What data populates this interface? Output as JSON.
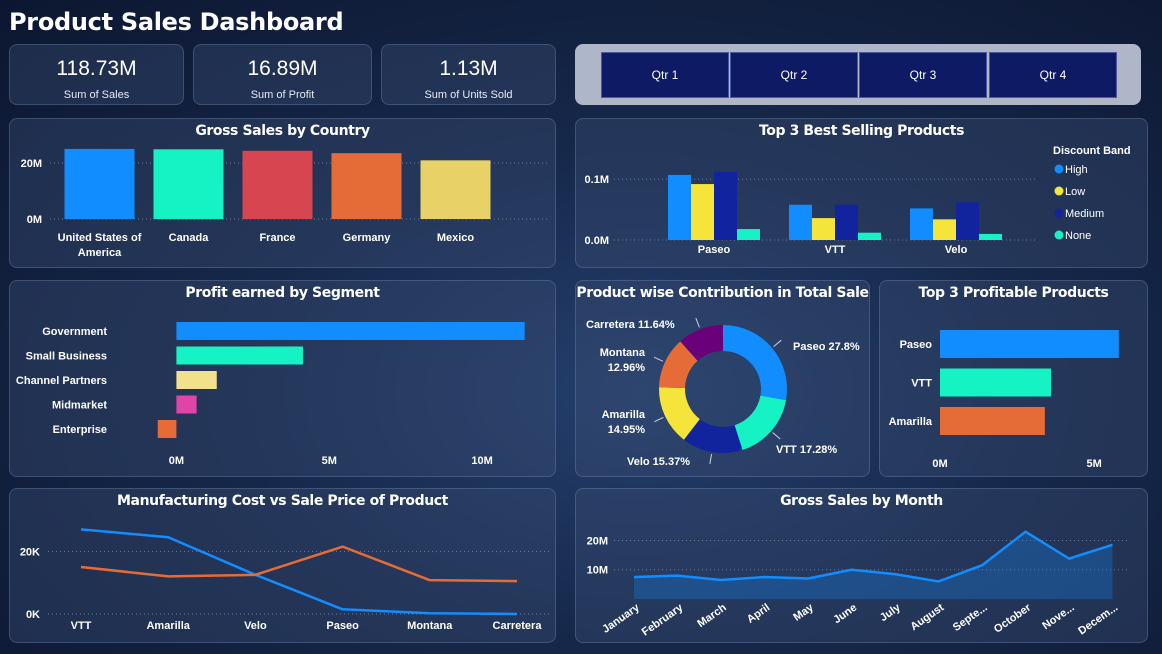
{
  "dashboard_title": "Product Sales Dashboard",
  "kpis": [
    {
      "value": "118.73M",
      "label": "Sum of  Sales"
    },
    {
      "value": "16.89M",
      "label": "Sum of Profit"
    },
    {
      "value": "1.13M",
      "label": "Sum of Units Sold"
    }
  ],
  "slicer": {
    "quarters": [
      "Qtr 1",
      "Qtr 2",
      "Qtr 3",
      "Qtr 4"
    ]
  },
  "colors": {
    "blue": "#118dff",
    "teal": "#15f2c4",
    "red": "#d64550",
    "orange": "#e66c37",
    "yellow": "#e8d166",
    "navy": "#12239e",
    "purple": "#6b007b",
    "pink": "#e044a7",
    "lightyellow": "#f2e08c",
    "bright_yellow": "#f5e53a",
    "mid_blue": "#1a6fe0"
  },
  "chart_data": [
    {
      "id": "country",
      "type": "bar",
      "title": "Gross Sales by Country",
      "categories": [
        "United States of America",
        "Canada",
        "France",
        "Germany",
        "Mexico"
      ],
      "values": [
        25.03,
        24.89,
        24.35,
        23.51,
        20.95
      ],
      "ylim": [
        0,
        25
      ],
      "yticks": [
        0,
        20
      ],
      "ytick_labels": [
        "0M",
        "20M"
      ],
      "colors": [
        "#118dff",
        "#15f2c4",
        "#d64550",
        "#e66c37",
        "#e8d166"
      ]
    },
    {
      "id": "top3",
      "type": "bar",
      "title": "Top 3 Best Selling Products",
      "categories": [
        "Paseo",
        "VTT",
        "Velo"
      ],
      "series": [
        {
          "name": "High",
          "values": [
            0.107,
            0.058,
            0.052
          ],
          "color": "#118dff"
        },
        {
          "name": "Low",
          "values": [
            0.092,
            0.036,
            0.034
          ],
          "color": "#f5e53a"
        },
        {
          "name": "Medium",
          "values": [
            0.112,
            0.058,
            0.062
          ],
          "color": "#12239e"
        },
        {
          "name": "None",
          "values": [
            0.018,
            0.012,
            0.01
          ],
          "color": "#15f2c4"
        }
      ],
      "legend_title": "Discount Band",
      "ylim": [
        0,
        0.125
      ],
      "yticks": [
        0,
        0.1
      ],
      "ytick_labels": [
        "0.0M",
        "0.1M"
      ]
    },
    {
      "id": "segment",
      "type": "bar",
      "title": "Profit earned by Segment",
      "categories": [
        "Government",
        "Small Business",
        "Channel Partners",
        "Midmarket",
        "Enterprise"
      ],
      "values": [
        11.39,
        4.14,
        1.32,
        0.66,
        -0.61
      ],
      "xlim": [
        -0.7,
        11.5
      ],
      "xticks": [
        0,
        5,
        10
      ],
      "xtick_labels": [
        "0M",
        "5M",
        "10M"
      ],
      "colors": [
        "#118dff",
        "#15f2c4",
        "#f2e08c",
        "#e044a7",
        "#e66c37"
      ]
    },
    {
      "id": "donut",
      "type": "pie",
      "title": "Product wise Contribution in Total Sale",
      "slices": [
        {
          "label": "Paseo",
          "pct": 27.8,
          "text": "Paseo 27.8%",
          "color": "#118dff"
        },
        {
          "label": "VTT",
          "pct": 17.28,
          "text": "VTT 17.28%",
          "color": "#15f2c4"
        },
        {
          "label": "Velo",
          "pct": 15.37,
          "text": "Velo 15.37%",
          "color": "#12239e"
        },
        {
          "label": "Amarilla",
          "pct": 14.95,
          "text": "Amarilla\n14.95%",
          "color": "#f5e53a"
        },
        {
          "label": "Montana",
          "pct": 12.96,
          "text": "Montana\n12.96%",
          "color": "#e66c37"
        },
        {
          "label": "Carretera",
          "pct": 11.64,
          "text": "Carretera 11.64%",
          "color": "#6b007b"
        }
      ]
    },
    {
      "id": "profitable",
      "type": "bar",
      "title": "Top 3 Profitable Products",
      "categories": [
        "Paseo",
        "VTT",
        "Amarilla"
      ],
      "values": [
        5.8,
        3.6,
        3.4
      ],
      "xlim": [
        0,
        6
      ],
      "xticks": [
        0,
        5
      ],
      "xtick_labels": [
        "0M",
        "5M"
      ],
      "colors": [
        "#118dff",
        "#15f2c4",
        "#e66c37"
      ]
    },
    {
      "id": "cost",
      "type": "line",
      "title": "Manufacturing Cost vs Sale Price of Product",
      "categories": [
        "VTT",
        "Amarilla",
        "Velo",
        "Paseo",
        "Montana",
        "Carretera"
      ],
      "series": [
        {
          "name": "Manufacturing Cost",
          "values": [
            27000,
            24500,
            12500,
            1500,
            250,
            0
          ],
          "color": "#118dff"
        },
        {
          "name": "Sale Price",
          "values": [
            15000,
            12000,
            12500,
            21500,
            10800,
            10500
          ],
          "color": "#e66c37"
        }
      ],
      "ylim": [
        0,
        30000
      ],
      "yticks": [
        0,
        20000
      ],
      "ytick_labels": [
        "0K",
        "20K"
      ]
    },
    {
      "id": "month",
      "type": "area",
      "title": "Gross Sales by Month",
      "categories": [
        "January",
        "February",
        "March",
        "April",
        "May",
        "June",
        "July",
        "August",
        "Septe...",
        "October",
        "Nove...",
        "Decem..."
      ],
      "values": [
        7.5,
        8,
        6.5,
        7.5,
        7,
        10,
        8.5,
        6,
        11.5,
        23,
        13.8,
        18.5
      ],
      "ylim": [
        0,
        27
      ],
      "yticks": [
        10,
        20
      ],
      "ytick_labels": [
        "10M",
        "20M"
      ],
      "color": "#118dff"
    }
  ]
}
